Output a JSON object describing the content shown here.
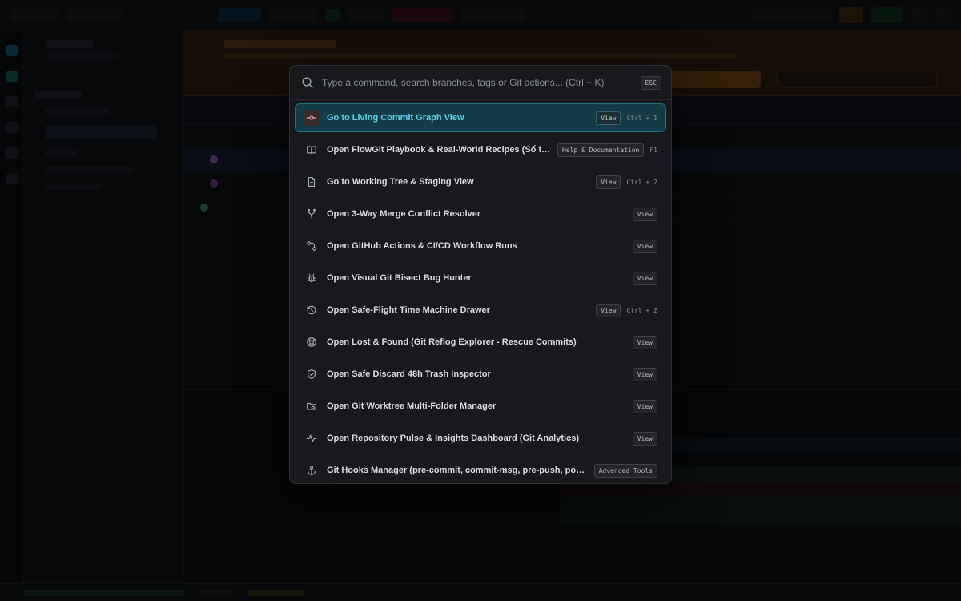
{
  "search": {
    "placeholder": "Type a command, search branches, tags or Git actions... (Ctrl + K)",
    "esc_label": "ESC"
  },
  "commands": [
    {
      "icon": "commit-icon",
      "label": "Go to Living Commit Graph View",
      "tag": "View",
      "shortcut": "Ctrl + 1",
      "active": true
    },
    {
      "icon": "book-icon",
      "label": "Open FlowGit Playbook & Real-World Recipes (Sổ tay Thực chiến)",
      "tag": "Help & Documentation",
      "shortcut": "F1",
      "active": false
    },
    {
      "icon": "file-icon",
      "label": "Go to Working Tree & Staging View",
      "tag": "View",
      "shortcut": "Ctrl + 2",
      "active": false
    },
    {
      "icon": "merge-icon",
      "label": "Open 3-Way Merge Conflict Resolver",
      "tag": "View",
      "shortcut": "",
      "active": false
    },
    {
      "icon": "workflow-icon",
      "label": "Open GitHub Actions & CI/CD Workflow Runs",
      "tag": "View",
      "shortcut": "",
      "active": false
    },
    {
      "icon": "bug-icon",
      "label": "Open Visual Git Bisect Bug Hunter",
      "tag": "View",
      "shortcut": "",
      "active": false
    },
    {
      "icon": "history-icon",
      "label": "Open Safe-Flight Time Machine Drawer",
      "tag": "View",
      "shortcut": "Ctrl + Z",
      "active": false
    },
    {
      "icon": "lifebuoy-icon",
      "label": "Open Lost & Found (Git Reflog Explorer - Rescue Commits)",
      "tag": "View",
      "shortcut": "",
      "active": false
    },
    {
      "icon": "shield-icon",
      "label": "Open Safe Discard 48h Trash Inspector",
      "tag": "View",
      "shortcut": "",
      "active": false
    },
    {
      "icon": "folder-search-icon",
      "label": "Open Git Worktree Multi-Folder Manager",
      "tag": "View",
      "shortcut": "",
      "active": false
    },
    {
      "icon": "activity-icon",
      "label": "Open Repository Pulse & Insights Dashboard (Git Analytics)",
      "tag": "View",
      "shortcut": "",
      "active": false
    },
    {
      "icon": "anchor-icon",
      "label": "Git Hooks Manager (pre-commit, commit-msg, pre-push, post-merge)",
      "tag": "Advanced Tools",
      "shortcut": "",
      "active": false
    }
  ],
  "colors": {
    "accent": "#5ed3ec",
    "active_bg": "#133c47",
    "palette_bg": "#18191c"
  }
}
